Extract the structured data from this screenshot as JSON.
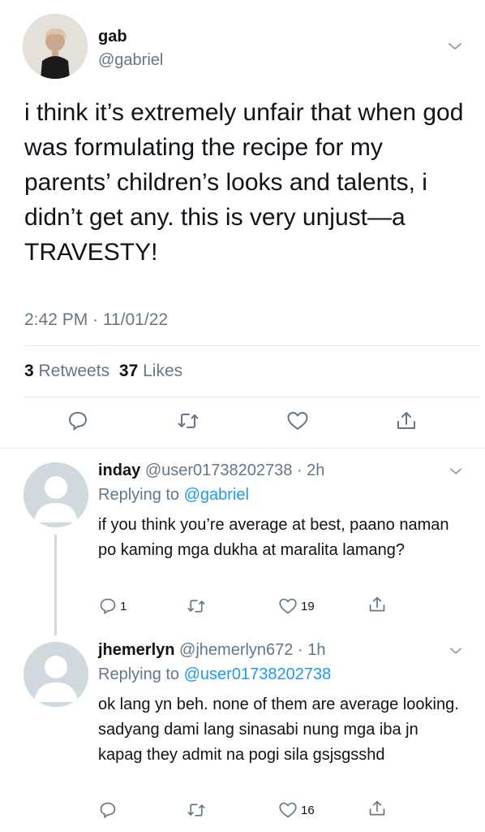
{
  "tweet": {
    "name": "gab",
    "handle": "@gabriel",
    "text": "i think it’s extremely unfair that when god was formulating the recipe for my parents’ children’s looks and talents, i didn’t get any. this is very unjust—a TRAVESTY!",
    "time": "2:42 PM · 11/01/22",
    "retweets_count": "3",
    "retweets_label": "Retweets",
    "likes_count": "37",
    "likes_label": "Likes"
  },
  "replies": [
    {
      "name": "inday",
      "handle_time": "@user01738202738 · 2h",
      "replying_prefix": "Replying to ",
      "replying_to": "@gabriel",
      "text": "if you think you’re average at best, paano naman po kaming mga dukha at maralita lamang?",
      "reply_count": "1",
      "like_count": "19"
    },
    {
      "name": "jhemerlyn",
      "handle_time": "@jhemerlyn672 · 1h",
      "replying_prefix": "Replying to ",
      "replying_to": "@user01738202738",
      "text": "ok lang yn beh. none of them are average looking. sadyang dami lang sinasabi nung mga iba jn kapag they admit na pogi sila gsjsgsshd",
      "reply_count": "",
      "like_count": "16"
    }
  ],
  "icons": {
    "reply": "reply-icon",
    "retweet": "retweet-icon",
    "like": "like-icon",
    "share": "share-icon",
    "more": "chevron-down-icon"
  },
  "colors": {
    "accent": "#1d9bf0",
    "secondary_text": "#657786",
    "divider": "#e1e8ed"
  }
}
